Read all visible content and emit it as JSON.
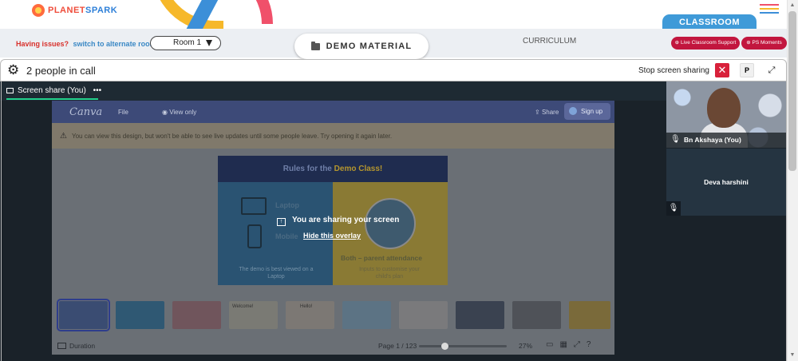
{
  "brand": {
    "logo_text_a": "PLANET",
    "logo_text_b": "SPARK"
  },
  "colors": {
    "accent_red": "#d8203a",
    "classroom_blue": "#3f9ad8",
    "support_red": "#c2163e",
    "share_green": "#22d08c",
    "hamburger": [
      "#f0506a",
      "#f6b82a",
      "#3c8fd8"
    ]
  },
  "header": {
    "classroom_tab": "CLASSROOM",
    "issues_text": "Having issues?",
    "issues_link": "switch to alternate room",
    "room_select": "Room 1",
    "demo_material": "DEMO MATERIAL",
    "curriculum": "CURRICULUM",
    "live_support": "Live Classroom Support",
    "ps_moments": "PS Moments"
  },
  "call": {
    "people": "2 people in call",
    "stop_sharing": "Stop screen sharing",
    "stop_btn": "✕",
    "p_btn": "P",
    "expand_icon": "⤢"
  },
  "share": {
    "tab_label": "Screen share (You)",
    "tab_menu": "•••",
    "overlay_message": "You are sharing your screen",
    "hide_overlay": "Hide this overlay"
  },
  "canva": {
    "logo": "Canva",
    "file": "File",
    "view_only": "View only",
    "share": "Share",
    "sign_up": "Sign up",
    "warning": "You can view this design, but won't be able to see live updates until some people leave. Try opening it again later.",
    "slide": {
      "title_a": "Rules for the ",
      "title_b": "Demo Class!",
      "laptop": "Laptop",
      "mobile": "Mobile",
      "demo_note": "The demo is best viewed on a Laptop",
      "parent": "Both – parent attendance",
      "customise": "Inputs to customise your child's plan"
    },
    "thumbnails": [
      "",
      "",
      "",
      "Welcome!",
      "Hello!",
      "",
      "",
      "",
      "",
      ""
    ],
    "duration": "Duration",
    "page": "Page 1 / 123",
    "zoom": "27%"
  },
  "participants": [
    {
      "name": "Bn Akshaya (You)"
    },
    {
      "name": "Deva harshini"
    }
  ]
}
